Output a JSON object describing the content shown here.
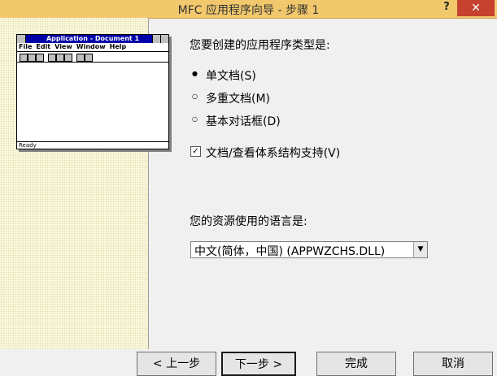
{
  "window": {
    "title": "MFC 应用程序向导 - 步骤 1",
    "help_label": "?",
    "close_label": "✕"
  },
  "preview": {
    "title": "Application - Document 1",
    "menu": [
      "File",
      "Edit",
      "View",
      "Window",
      "Help"
    ],
    "status": "Ready"
  },
  "app_type": {
    "prompt": "您要创建的应用程序类型是:",
    "options": [
      {
        "label": "单文档(S)",
        "selected": true
      },
      {
        "label": "多重文档(M)",
        "selected": false
      },
      {
        "label": "基本对话框(D)",
        "selected": false
      }
    ],
    "docview_label": "文档/查看体系结构支持(V)",
    "docview_checked": true
  },
  "language": {
    "prompt": "您的资源使用的语言是:",
    "selected": "中文(简体，中国) (APPWZCHS.DLL)"
  },
  "buttons": {
    "back": "< 上一步",
    "next": "下一步 >",
    "finish": "完成",
    "cancel": "取消"
  }
}
